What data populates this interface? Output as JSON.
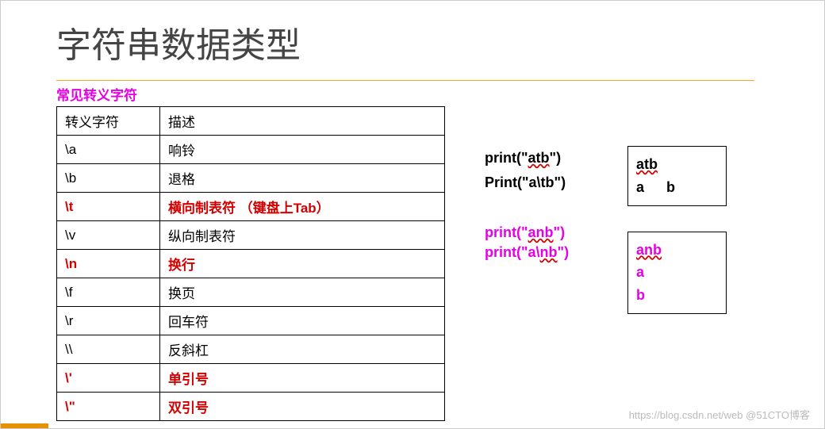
{
  "title": "字符串数据类型",
  "subtitle": "常见转义字符",
  "table": {
    "headers": {
      "c1": "转义字符",
      "c2": "描述"
    },
    "rows": [
      {
        "esc": "\\a",
        "desc": "响铃",
        "red": false
      },
      {
        "esc": "\\b",
        "desc": "退格",
        "red": false
      },
      {
        "esc": "\\t",
        "desc": "横向制表符 （键盘上Tab）",
        "red": true
      },
      {
        "esc": "\\v",
        "desc": "纵向制表符",
        "red": false
      },
      {
        "esc": "\\n",
        "desc": "换行",
        "red": true
      },
      {
        "esc": "\\f",
        "desc": "换页",
        "red": false
      },
      {
        "esc": "\\r",
        "desc": "回车符",
        "red": false
      },
      {
        "esc": "\\\\",
        "desc": "反斜杠",
        "red": false
      },
      {
        "esc": "\\'",
        "desc": "单引号",
        "red": true
      },
      {
        "esc": "\\\"",
        "desc": "双引号",
        "red": true
      }
    ]
  },
  "snippets": {
    "s1_pre": "print(\"",
    "s1_mid": "atb",
    "s1_post": "\")",
    "s2": "Print(\"a\\tb\")",
    "s3_pre": "print(\"",
    "s3_mid": "anb",
    "s3_post": "\")",
    "s4_pre": "print(\"a\\",
    "s4_mid": "nb",
    "s4_post": "\")"
  },
  "outputs": {
    "box1_l1": "atb",
    "box1_l2a": "a",
    "box1_l2b": "b",
    "box2_l1": "anb",
    "box2_l2": "a",
    "box2_l3": "b"
  },
  "watermark": "https://blog.csdn.net/web @51CTO博客"
}
